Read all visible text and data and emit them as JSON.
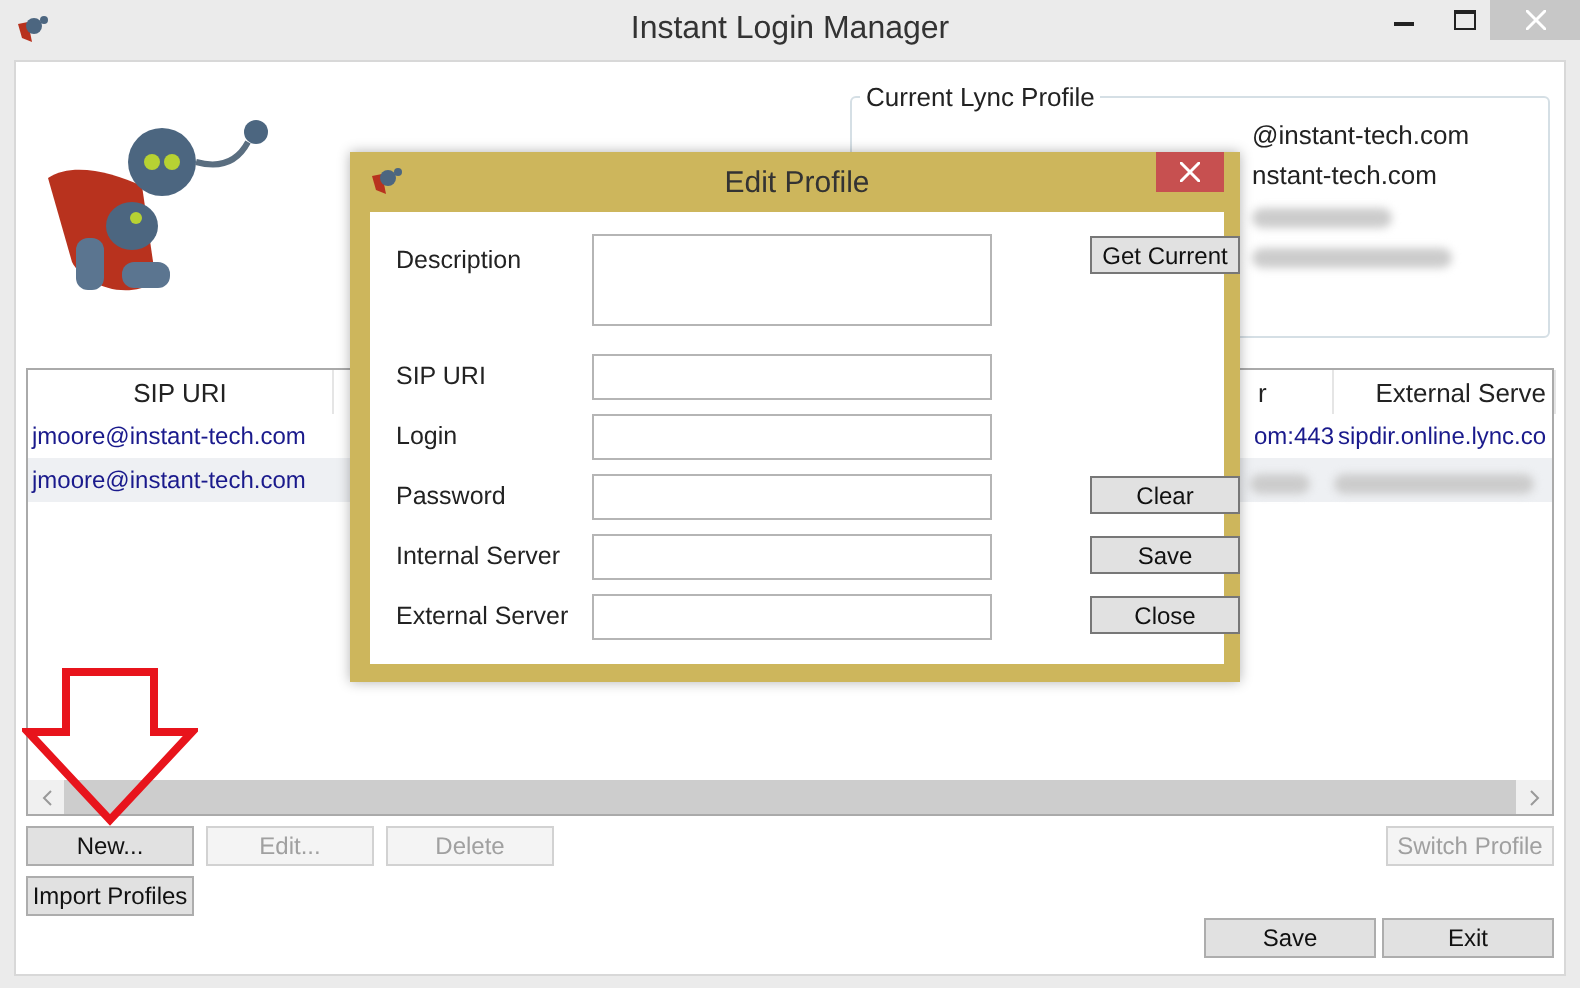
{
  "window": {
    "title": "Instant Login Manager"
  },
  "current_profile": {
    "title": "Current Lync Profile",
    "lines": [
      {
        "text": "@instant-tech.com"
      },
      {
        "text": "nstant-tech.com"
      },
      {
        "blurred": true
      },
      {
        "blurred": true
      }
    ]
  },
  "table": {
    "columns": [
      "SIP URI",
      "r",
      "External Serve"
    ],
    "rows": [
      {
        "cells": [
          "jmoore@instant-tech.com",
          "om:443",
          "sipdir.online.lync.co"
        ],
        "selected": false
      },
      {
        "cells": [
          "jmoore@instant-tech.com"
        ],
        "selected": true
      }
    ]
  },
  "buttons": [
    {
      "label": "New...",
      "disabled": false
    },
    {
      "label": "Edit...",
      "disabled": true
    },
    {
      "label": "Delete",
      "disabled": true
    }
  ],
  "switch_button": {
    "label": "Switch Profile",
    "disabled": true
  },
  "import_button": {
    "label": "Import Profiles",
    "disabled": false
  },
  "footer_buttons": [
    "Save",
    "Exit"
  ],
  "dialog": {
    "title": "Edit Profile",
    "fields": [
      {
        "label": "Description",
        "kind": "multiline",
        "button": "Get Current"
      },
      {
        "label": "SIP URI",
        "kind": "line"
      },
      {
        "label": "Login",
        "kind": "line"
      },
      {
        "label": "Password",
        "kind": "line",
        "button": "Clear"
      },
      {
        "label": "Internal Server",
        "kind": "line",
        "button": "Save"
      },
      {
        "label": "External Server",
        "kind": "line",
        "button": "Close"
      }
    ]
  }
}
